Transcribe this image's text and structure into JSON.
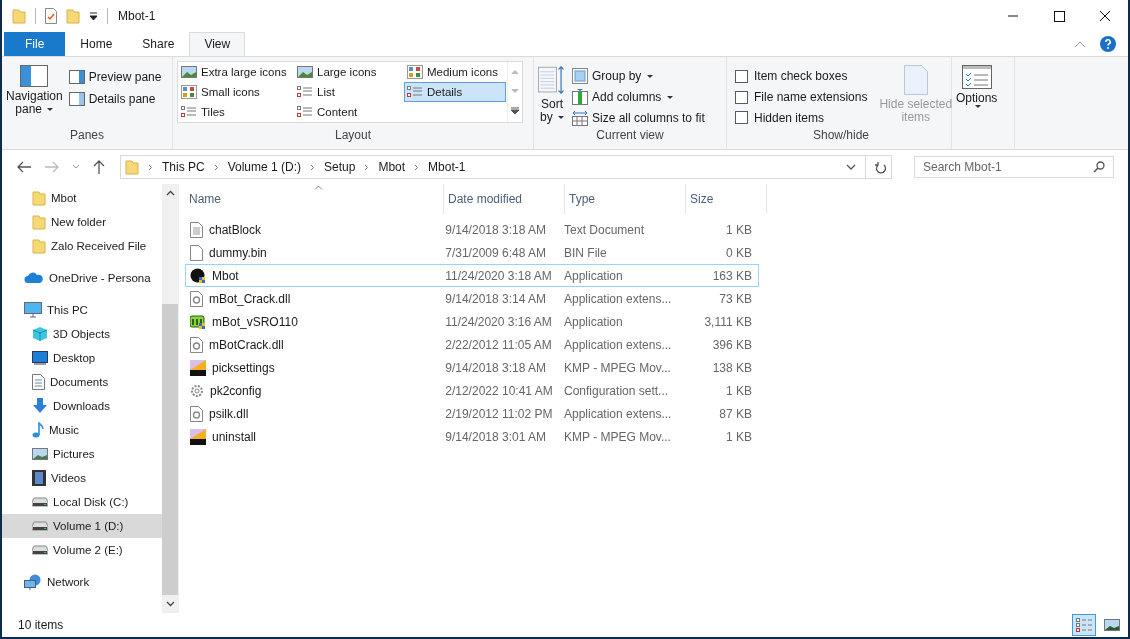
{
  "window": {
    "title": "Mbot-1"
  },
  "tabs": [
    {
      "label": "File",
      "kind": "file",
      "selected": false
    },
    {
      "label": "Home",
      "kind": "tab",
      "selected": false
    },
    {
      "label": "Share",
      "kind": "tab",
      "selected": false
    },
    {
      "label": "View",
      "kind": "tab",
      "selected": true
    }
  ],
  "ribbon": {
    "panes": {
      "big_button": [
        "Navigation",
        "pane"
      ],
      "items": [
        "Preview pane",
        "Details pane"
      ],
      "label": "Panes"
    },
    "layout": {
      "options": [
        {
          "label": "Extra large icons",
          "kind": "xl",
          "selected": false
        },
        {
          "label": "Large icons",
          "kind": "large",
          "selected": false
        },
        {
          "label": "Medium icons",
          "kind": "medium",
          "selected": false
        },
        {
          "label": "Small icons",
          "kind": "small",
          "selected": false
        },
        {
          "label": "List",
          "kind": "list",
          "selected": false
        },
        {
          "label": "Details",
          "kind": "details",
          "selected": true
        },
        {
          "label": "Tiles",
          "kind": "tiles",
          "selected": false
        },
        {
          "label": "Content",
          "kind": "content",
          "selected": false
        }
      ],
      "label": "Layout"
    },
    "current_view": {
      "sort": [
        "Sort",
        "by"
      ],
      "items": [
        {
          "label": "Group by",
          "kind": "group",
          "dropdown": true
        },
        {
          "label": "Add columns",
          "kind": "columns",
          "dropdown": true
        },
        {
          "label": "Size all columns to fit",
          "kind": "fit",
          "dropdown": false
        }
      ],
      "label": "Current view"
    },
    "show_hide": {
      "checkboxes": [
        {
          "label": "Item check boxes",
          "checked": false
        },
        {
          "label": "File name extensions",
          "checked": false
        },
        {
          "label": "Hidden items",
          "checked": false
        }
      ],
      "hide_selected": {
        "label": [
          "Hide selected",
          "items"
        ],
        "disabled": true
      },
      "label": "Show/hide"
    },
    "options": {
      "label": "Options"
    }
  },
  "address": {
    "breadcrumbs": [
      "This PC",
      "Volume 1 (D:)",
      "Setup",
      "Mbot",
      "Mbot-1"
    ]
  },
  "search": {
    "placeholder": "Search Mbot-1"
  },
  "sidebar": {
    "pinned": [
      {
        "label": "Mbot",
        "selected": false
      },
      {
        "label": "New folder",
        "selected": false
      },
      {
        "label": "Zalo Received File",
        "selected": false
      }
    ],
    "items": [
      {
        "label": "OneDrive - Persona",
        "kind": "onedrive",
        "selected": false
      },
      {
        "label": "This PC",
        "kind": "pc",
        "selected": false,
        "children": [
          {
            "label": "3D Objects",
            "kind": "cube",
            "selected": false
          },
          {
            "label": "Desktop",
            "kind": "desktop",
            "selected": false
          },
          {
            "label": "Documents",
            "kind": "documents",
            "selected": false
          },
          {
            "label": "Downloads",
            "kind": "downloads",
            "selected": false
          },
          {
            "label": "Music",
            "kind": "music",
            "selected": false
          },
          {
            "label": "Pictures",
            "kind": "pictures",
            "selected": false
          },
          {
            "label": "Videos",
            "kind": "videos",
            "selected": false
          },
          {
            "label": "Local Disk (C:)",
            "kind": "drive",
            "selected": false
          },
          {
            "label": "Volume 1 (D:)",
            "kind": "drive",
            "selected": true
          },
          {
            "label": "Volume 2 (E:)",
            "kind": "drive",
            "selected": false
          }
        ]
      },
      {
        "label": "Network",
        "kind": "network",
        "selected": false
      }
    ]
  },
  "table": {
    "columns": [
      {
        "label": "Name",
        "sorted": true
      },
      {
        "label": "Date modified",
        "sorted": false
      },
      {
        "label": "Type",
        "sorted": false
      },
      {
        "label": "Size",
        "sorted": false
      }
    ],
    "rows": [
      {
        "name": "chatBlock",
        "kind": "text",
        "date": "9/14/2018 3:18 AM",
        "type": "Text Document",
        "size": "1 KB",
        "focused": false
      },
      {
        "name": "dummy.bin",
        "kind": "blank",
        "date": "7/31/2009 6:48 AM",
        "type": "BIN File",
        "size": "0 KB",
        "focused": false
      },
      {
        "name": "Mbot",
        "kind": "app-round",
        "date": "11/24/2020 3:18 AM",
        "type": "Application",
        "size": "163 KB",
        "focused": true
      },
      {
        "name": "mBot_Crack.dll",
        "kind": "dll",
        "date": "9/14/2018 3:14 AM",
        "type": "Application extens...",
        "size": "73 KB",
        "focused": false
      },
      {
        "name": "mBot_vSRO110",
        "kind": "app-green",
        "date": "11/24/2020 3:16 AM",
        "type": "Application",
        "size": "3,111 KB",
        "focused": false
      },
      {
        "name": "mBotCrack.dll",
        "kind": "dll",
        "date": "2/22/2012 11:05 AM",
        "type": "Application extens...",
        "size": "396 KB",
        "focused": false
      },
      {
        "name": "picksettings",
        "kind": "dat",
        "date": "9/14/2018 3:18 AM",
        "type": "KMP - MPEG Mov...",
        "size": "138 KB",
        "focused": false
      },
      {
        "name": "pk2config",
        "kind": "config",
        "date": "2/12/2022 10:41 AM",
        "type": "Configuration sett...",
        "size": "1 KB",
        "focused": false
      },
      {
        "name": "psilk.dll",
        "kind": "dll",
        "date": "2/19/2012 11:02 PM",
        "type": "Application extens...",
        "size": "87 KB",
        "focused": false
      },
      {
        "name": "uninstall",
        "kind": "dat",
        "date": "9/14/2018 3:01 AM",
        "type": "KMP - MPEG Mov...",
        "size": "1 KB",
        "focused": false
      }
    ]
  },
  "status_bar": {
    "count": "10 items",
    "views": [
      {
        "kind": "details",
        "selected": true
      },
      {
        "kind": "large",
        "selected": false
      }
    ]
  }
}
